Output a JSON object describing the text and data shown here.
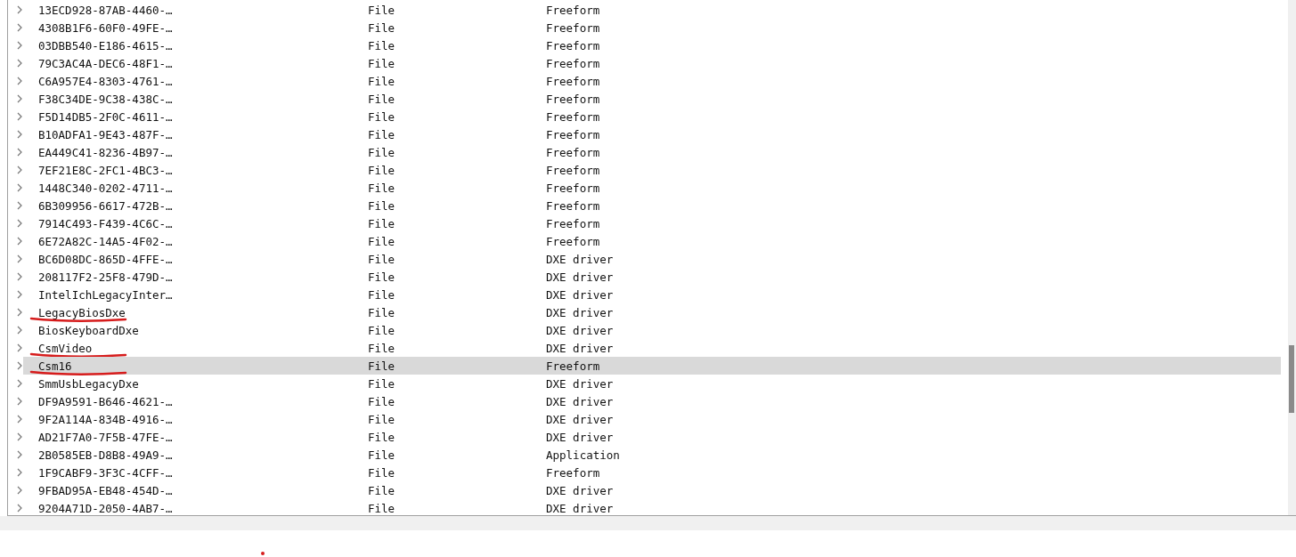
{
  "tree": {
    "rows": [
      {
        "name": "13ECD928-87AB-4460-…",
        "type": "File",
        "subtype": "Freeform",
        "selected": false,
        "underlined": false
      },
      {
        "name": "4308B1F6-60F0-49FE-…",
        "type": "File",
        "subtype": "Freeform",
        "selected": false,
        "underlined": false
      },
      {
        "name": "03DBB540-E186-4615-…",
        "type": "File",
        "subtype": "Freeform",
        "selected": false,
        "underlined": false
      },
      {
        "name": "79C3AC4A-DEC6-48F1-…",
        "type": "File",
        "subtype": "Freeform",
        "selected": false,
        "underlined": false
      },
      {
        "name": "C6A957E4-8303-4761-…",
        "type": "File",
        "subtype": "Freeform",
        "selected": false,
        "underlined": false
      },
      {
        "name": "F38C34DE-9C38-438C-…",
        "type": "File",
        "subtype": "Freeform",
        "selected": false,
        "underlined": false
      },
      {
        "name": "F5D14DB5-2F0C-4611-…",
        "type": "File",
        "subtype": "Freeform",
        "selected": false,
        "underlined": false
      },
      {
        "name": "B10ADFA1-9E43-487F-…",
        "type": "File",
        "subtype": "Freeform",
        "selected": false,
        "underlined": false
      },
      {
        "name": "EA449C41-8236-4B97-…",
        "type": "File",
        "subtype": "Freeform",
        "selected": false,
        "underlined": false
      },
      {
        "name": "7EF21E8C-2FC1-4BC3-…",
        "type": "File",
        "subtype": "Freeform",
        "selected": false,
        "underlined": false
      },
      {
        "name": "1448C340-0202-4711-…",
        "type": "File",
        "subtype": "Freeform",
        "selected": false,
        "underlined": false
      },
      {
        "name": "6B309956-6617-472B-…",
        "type": "File",
        "subtype": "Freeform",
        "selected": false,
        "underlined": false
      },
      {
        "name": "7914C493-F439-4C6C-…",
        "type": "File",
        "subtype": "Freeform",
        "selected": false,
        "underlined": false
      },
      {
        "name": "6E72A82C-14A5-4F02-…",
        "type": "File",
        "subtype": "Freeform",
        "selected": false,
        "underlined": false
      },
      {
        "name": "BC6D08DC-865D-4FFE-…",
        "type": "File",
        "subtype": "DXE driver",
        "selected": false,
        "underlined": false
      },
      {
        "name": "208117F2-25F8-479D-…",
        "type": "File",
        "subtype": "DXE driver",
        "selected": false,
        "underlined": false
      },
      {
        "name": "IntelIchLegacyInter…",
        "type": "File",
        "subtype": "DXE driver",
        "selected": false,
        "underlined": false
      },
      {
        "name": "LegacyBiosDxe",
        "type": "File",
        "subtype": "DXE driver",
        "selected": false,
        "underlined": true
      },
      {
        "name": "BiosKeyboardDxe",
        "type": "File",
        "subtype": "DXE driver",
        "selected": false,
        "underlined": false
      },
      {
        "name": "CsmVideo",
        "type": "File",
        "subtype": "DXE driver",
        "selected": false,
        "underlined": true
      },
      {
        "name": "Csm16",
        "type": "File",
        "subtype": "Freeform",
        "selected": true,
        "underlined": true
      },
      {
        "name": "SmmUsbLegacyDxe",
        "type": "File",
        "subtype": "DXE driver",
        "selected": false,
        "underlined": false
      },
      {
        "name": "DF9A9591-B646-4621-…",
        "type": "File",
        "subtype": "DXE driver",
        "selected": false,
        "underlined": false
      },
      {
        "name": "9F2A114A-834B-4916-…",
        "type": "File",
        "subtype": "DXE driver",
        "selected": false,
        "underlined": false
      },
      {
        "name": "AD21F7A0-7F5B-47FE-…",
        "type": "File",
        "subtype": "DXE driver",
        "selected": false,
        "underlined": false
      },
      {
        "name": "2B0585EB-D8B8-49A9-…",
        "type": "File",
        "subtype": "Application",
        "selected": false,
        "underlined": false
      },
      {
        "name": "1F9CABF9-3F3C-4CFF-…",
        "type": "File",
        "subtype": "Freeform",
        "selected": false,
        "underlined": false
      },
      {
        "name": "9FBAD95A-EB48-454D-…",
        "type": "File",
        "subtype": "DXE driver",
        "selected": false,
        "underlined": false
      },
      {
        "name": "9204A71D-2050-4AB7-…",
        "type": "File",
        "subtype": "DXE driver",
        "selected": false,
        "underlined": false
      }
    ]
  },
  "annotation_dot": true
}
